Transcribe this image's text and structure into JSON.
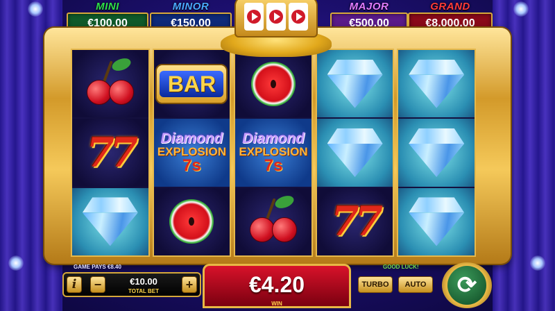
{
  "jackpots": [
    {
      "label": "MINI",
      "value": "€100.00",
      "label_color": "#2ee04a",
      "box_color": "#0f5a2a"
    },
    {
      "label": "MINOR",
      "value": "€150.00",
      "label_color": "#4aa8ff",
      "box_color": "#0e2a7a"
    },
    {
      "label": "MAJOR",
      "value": "€500.00",
      "label_color": "#e07aff",
      "box_color": "#5a1a8a"
    },
    {
      "label": "GRAND",
      "value": "€8,000.00",
      "label_color": "#ff3a3a",
      "box_color": "#8a0a1a"
    }
  ],
  "reels": [
    [
      "cherry",
      "seven",
      "diamond"
    ],
    [
      "bar",
      "logo",
      "watermelon"
    ],
    [
      "watermelon",
      "logo",
      "cherry"
    ],
    [
      "diamond",
      "diamond",
      "seven"
    ],
    [
      "diamond",
      "diamond",
      "diamond"
    ]
  ],
  "symbols": {
    "bar": "BAR",
    "seven": "77",
    "logo": {
      "line1": "Diamond",
      "line2": "EXPLOSION",
      "line3": "7s"
    }
  },
  "footer": {
    "game_pays": "GAME PAYS €8.40",
    "good_luck": "GOOD LUCK!",
    "info_label": "i",
    "minus_label": "−",
    "plus_label": "+",
    "bet_value": "€10.00",
    "bet_label": "TOTAL BET",
    "win_value": "€4.20",
    "win_label": "WIN",
    "turbo_label": "TURBO",
    "auto_label": "AUTO",
    "spin_icon": "refresh-arrows-icon",
    "spin_glyph": "⟳"
  }
}
